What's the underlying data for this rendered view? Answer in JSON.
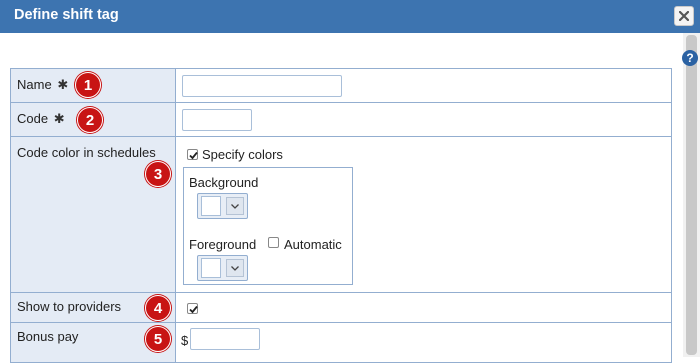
{
  "dialog": {
    "title": "Define shift tag",
    "help_glyph": "?",
    "required_marker": "✱"
  },
  "rows": {
    "name": {
      "label": "Name",
      "badge": "1",
      "value": ""
    },
    "code": {
      "label": "Code",
      "badge": "2",
      "value": ""
    },
    "code_color": {
      "label": "Code color in schedules",
      "badge": "3",
      "specify_colors_label": "Specify colors",
      "specify_colors_checked": true,
      "background_label": "Background",
      "foreground_label": "Foreground",
      "automatic_label": "Automatic",
      "automatic_checked": false,
      "background_color": "#ffffff",
      "foreground_color": "#ffffff"
    },
    "show_to_providers": {
      "label": "Show to providers",
      "badge": "4",
      "checked": true
    },
    "bonus_pay": {
      "label": "Bonus pay",
      "badge": "5",
      "currency": "$",
      "value": ""
    }
  },
  "colors": {
    "titlebar": "#3d74b0",
    "label_bg": "#e4ebf5",
    "border": "#93aed0",
    "badge": "#c81414"
  }
}
